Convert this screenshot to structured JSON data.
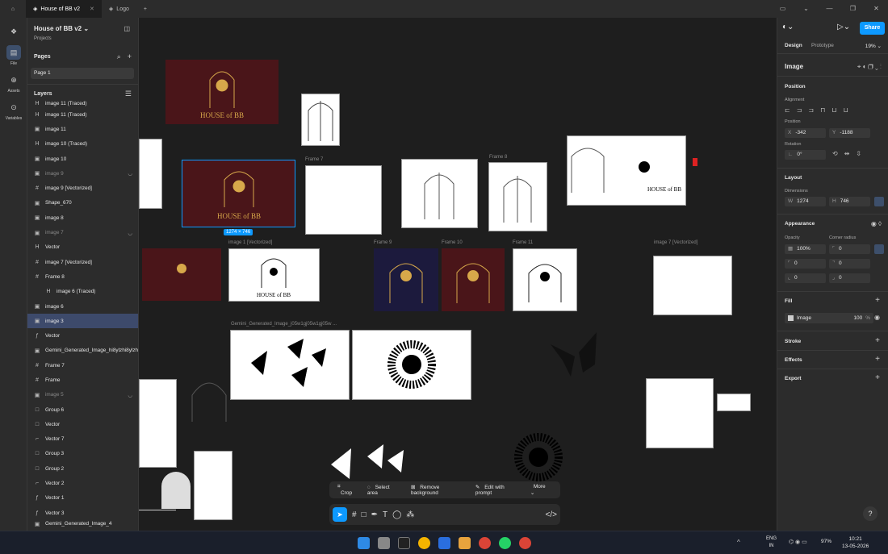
{
  "tabs": [
    {
      "label": "House of BB v2",
      "active": true
    },
    {
      "label": "Logo",
      "active": false
    }
  ],
  "rail": [
    {
      "label": "File",
      "active": true
    },
    {
      "label": "Assets",
      "active": false
    },
    {
      "label": "Variables",
      "active": false
    }
  ],
  "left_panel": {
    "file_name": "House of BB v2",
    "breadcrumb": "Projects",
    "pages_header": "Pages",
    "page": "Page 1",
    "layers_header": "Layers",
    "layers": [
      {
        "name": "image 11 (Traced)",
        "icon": "H",
        "state": "cut"
      },
      {
        "name": "image 11 (Traced)",
        "icon": "H",
        "state": ""
      },
      {
        "name": "image 11",
        "icon": "▣",
        "state": ""
      },
      {
        "name": "image 10 (Traced)",
        "icon": "H",
        "state": ""
      },
      {
        "name": "image 10",
        "icon": "▣",
        "state": ""
      },
      {
        "name": "image 9",
        "icon": "▣",
        "state": "dim"
      },
      {
        "name": "image 9 [Vectorized]",
        "icon": "#",
        "state": ""
      },
      {
        "name": "Shape_670",
        "icon": "▣",
        "state": ""
      },
      {
        "name": "image 8",
        "icon": "▣",
        "state": ""
      },
      {
        "name": "image 7",
        "icon": "▣",
        "state": "dim"
      },
      {
        "name": "Vector",
        "icon": "H",
        "state": ""
      },
      {
        "name": "image 7 [Vectorized]",
        "icon": "#",
        "state": ""
      },
      {
        "name": "Frame 8",
        "icon": "#",
        "state": ""
      },
      {
        "name": "image 6 (Traced)",
        "icon": "H",
        "state": "indent"
      },
      {
        "name": "image 6",
        "icon": "▣",
        "state": ""
      },
      {
        "name": "image 3",
        "icon": "▣",
        "state": "sel"
      },
      {
        "name": "Vector",
        "icon": "ƒ",
        "state": ""
      },
      {
        "name": "Gemini_Generated_Image_hi8ylzhi8ylzh",
        "icon": "▣",
        "state": ""
      },
      {
        "name": "Frame 7",
        "icon": "#",
        "state": ""
      },
      {
        "name": "Frame",
        "icon": "#",
        "state": ""
      },
      {
        "name": "image 5",
        "icon": "▣",
        "state": "dim"
      },
      {
        "name": "Group 6",
        "icon": "□",
        "state": ""
      },
      {
        "name": "Vector",
        "icon": "□",
        "state": ""
      },
      {
        "name": "Vector 7",
        "icon": "⌐",
        "state": ""
      },
      {
        "name": "Group 3",
        "icon": "□",
        "state": ""
      },
      {
        "name": "Group 2",
        "icon": "□",
        "state": ""
      },
      {
        "name": "Vector 2",
        "icon": "⌐",
        "state": ""
      },
      {
        "name": "Vector 1",
        "icon": "ƒ",
        "state": ""
      },
      {
        "name": "Vector 3",
        "icon": "ƒ",
        "state": ""
      },
      {
        "name": "Gemini_Generated_Image_4",
        "icon": "▣",
        "state": "cut"
      }
    ]
  },
  "canvas": {
    "frame_labels": {
      "frame7": "Frame 7",
      "frame8": "Frame 8",
      "image1v": "image 1 [Vectorized]",
      "frame9": "Frame 9",
      "frame10": "Frame 10",
      "frame11": "Frame 11",
      "image7v": "image 7 [Vectorized]",
      "gemini": "Gemini_Generated_Image_j05w1gj05w1gj05w ..."
    },
    "selection_size": "1274 × 746",
    "brand_text": "HOUSE of BB"
  },
  "toolbar_context": [
    "Crop",
    "Select area",
    "Remove background",
    "Edit with prompt",
    "More"
  ],
  "right_panel": {
    "tab_design": "Design",
    "tab_prototype": "Prototype",
    "zoom": "19%",
    "share": "Share",
    "layer_type": "Image",
    "position": "Position",
    "alignment": "Alignment",
    "position_label": "Position",
    "x": "-342",
    "y": "-1188",
    "rotation_label": "Rotation",
    "rotation": "0°",
    "layout": "Layout",
    "dimensions": "Dimensions",
    "w": "1274",
    "h": "746",
    "appearance": "Appearance",
    "opacity_label": "Opacity",
    "opacity": "100%",
    "radius_label": "Corner radius",
    "radius": "0",
    "r2": "0",
    "r3": "0",
    "r4": "0",
    "r5": "0",
    "fill": "Fill",
    "fill_type": "Image",
    "fill_opacity": "100",
    "fill_pct": "%",
    "stroke": "Stroke",
    "effects": "Effects",
    "export": "Export"
  },
  "taskbar": {
    "lang": "ENG",
    "region": "IN",
    "battery": "97%",
    "time": "10:21",
    "date": "13-05-2026"
  },
  "colors": {
    "accent": "#0d99ff",
    "selection": "#3d4a6b",
    "gold": "#d7a84a",
    "maroon": "#4a1519"
  }
}
